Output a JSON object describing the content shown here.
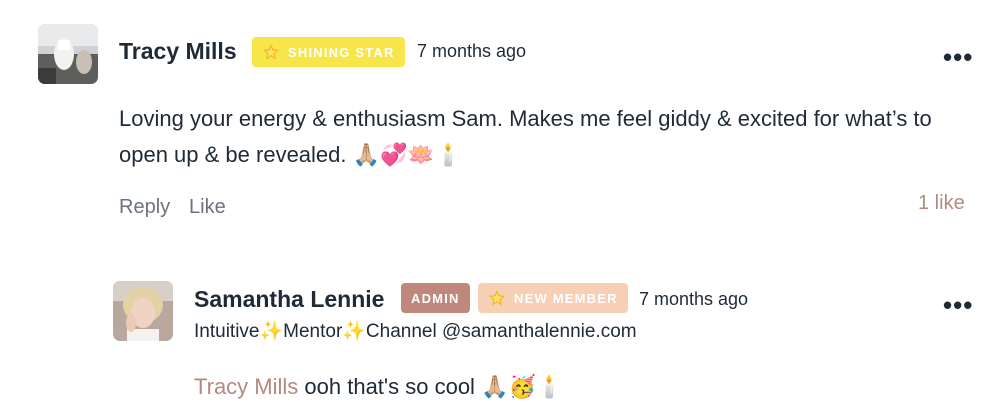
{
  "comments": [
    {
      "author": "Tracy Mills",
      "badge": "SHINING STAR",
      "time": "7 months ago",
      "text": "Loving your energy & enthusiasm Sam. Makes me feel giddy & excited for what’s to open up & be revealed. 🙏🏼💞🪷🕯️",
      "actions": {
        "reply": "Reply",
        "like": "Like"
      },
      "like_count": "1 like",
      "more": "•••"
    }
  ],
  "reply": {
    "author": "Samantha Lennie",
    "badges": [
      "ADMIN",
      "NEW MEMBER"
    ],
    "time": "7 months ago",
    "subtitle": "Intuitive✨Mentor✨Channel @samanthalennie.com",
    "mention": "Tracy Mills",
    "text": " ooh that's so cool 🙏🏼🥳🕯️",
    "more": "•••"
  },
  "colors": {
    "star_badge": "#f7e64a",
    "admin_badge": "#c0877d",
    "new_member_badge": "#f6cfb5",
    "mention": "#b48a80"
  }
}
